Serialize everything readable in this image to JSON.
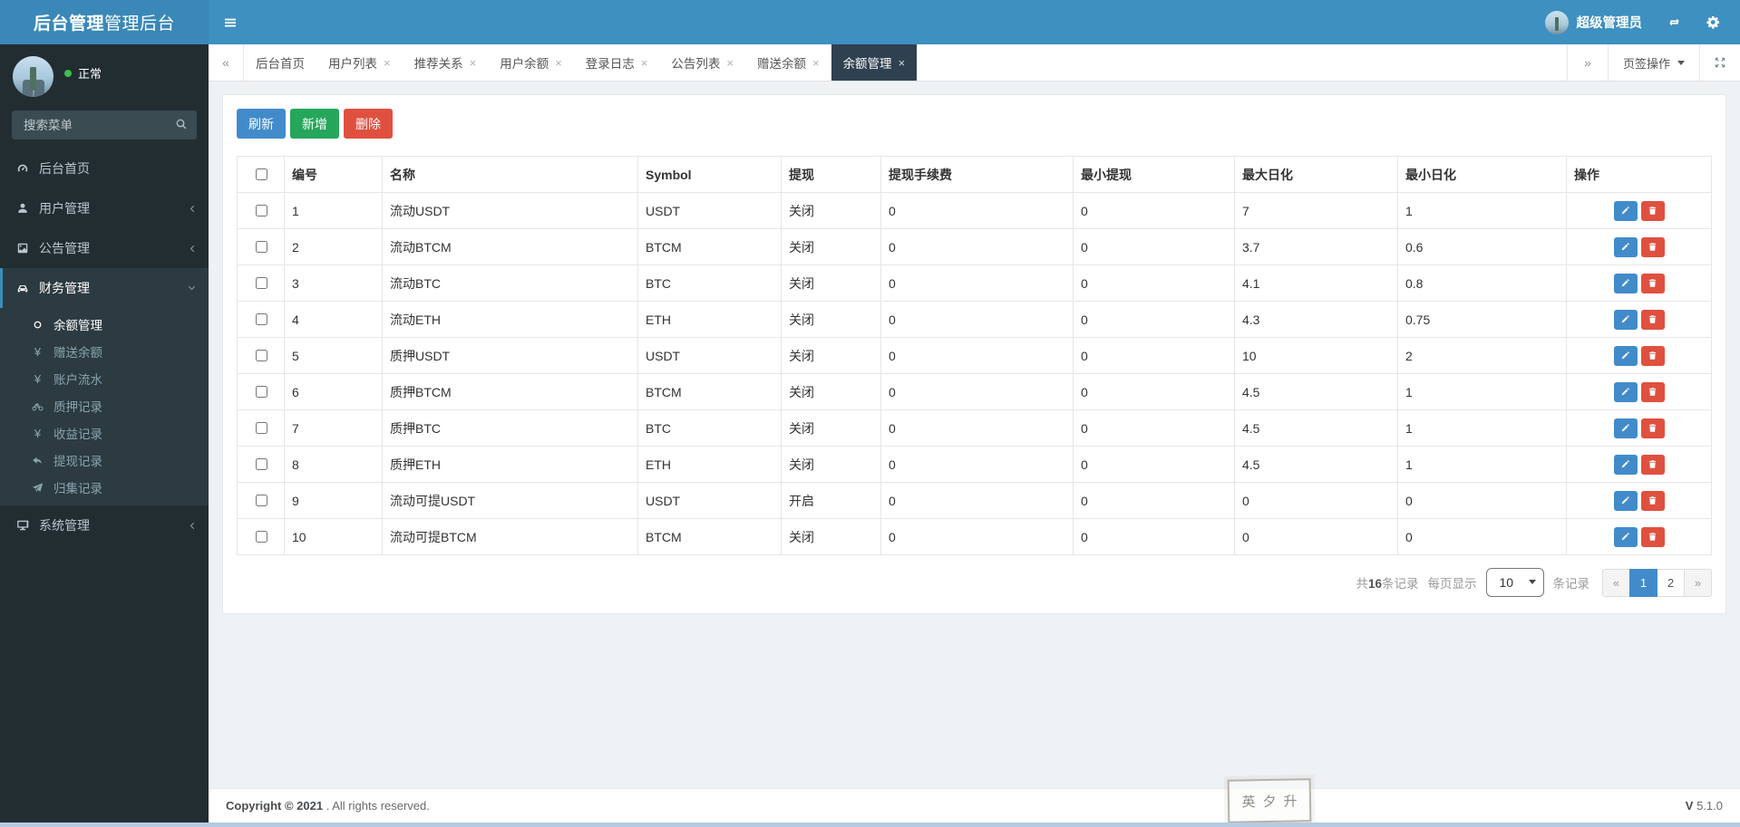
{
  "app": {
    "logo_bold": "后台管理",
    "logo_light": "管理后台"
  },
  "header": {
    "user_name": "超级管理员",
    "icons": [
      "hamburger-icon",
      "refresh-icon",
      "gear-icon"
    ]
  },
  "sidebar": {
    "status_label": "正常",
    "search_placeholder": "搜索菜单",
    "items": [
      {
        "label": "后台首页",
        "icon": "dashboard-icon"
      },
      {
        "label": "用户管理",
        "icon": "user-icon",
        "chevron": "left"
      },
      {
        "label": "公告管理",
        "icon": "image-icon",
        "chevron": "left"
      },
      {
        "label": "财务管理",
        "icon": "car-icon",
        "chevron": "down",
        "active": true,
        "children": [
          {
            "label": "余额管理",
            "icon": "circle-outline-icon",
            "active": true
          },
          {
            "label": "赠送余额",
            "icon": "yen-icon"
          },
          {
            "label": "账户流水",
            "icon": "yen-icon"
          },
          {
            "label": "质押记录",
            "icon": "motorcycle-icon"
          },
          {
            "label": "收益记录",
            "icon": "yen-icon"
          },
          {
            "label": "提现记录",
            "icon": "reply-arrow-icon"
          },
          {
            "label": "归集记录",
            "icon": "paper-plane-icon"
          }
        ]
      },
      {
        "label": "系统管理",
        "icon": "desktop-icon",
        "chevron": "left"
      }
    ]
  },
  "tabs": {
    "ops_label": "页签操作",
    "items": [
      {
        "label": "后台首页",
        "closable": false
      },
      {
        "label": "用户列表",
        "closable": true
      },
      {
        "label": "推荐关系",
        "closable": true
      },
      {
        "label": "用户余额",
        "closable": true
      },
      {
        "label": "登录日志",
        "closable": true
      },
      {
        "label": "公告列表",
        "closable": true
      },
      {
        "label": "赠送余额",
        "closable": true
      },
      {
        "label": "余额管理",
        "closable": true,
        "active": true
      }
    ]
  },
  "toolbar": {
    "refresh_label": "刷新",
    "add_label": "新增",
    "delete_label": "删除"
  },
  "table": {
    "columns": [
      {
        "key": "id",
        "label": "编号"
      },
      {
        "key": "name",
        "label": "名称"
      },
      {
        "key": "symbol",
        "label": "Symbol"
      },
      {
        "key": "withdraw",
        "label": "提现"
      },
      {
        "key": "fee",
        "label": "提现手续费"
      },
      {
        "key": "min_withdraw",
        "label": "最小提现"
      },
      {
        "key": "max_daily",
        "label": "最大日化"
      },
      {
        "key": "min_daily",
        "label": "最小日化"
      },
      {
        "key": "actions",
        "label": "操作"
      }
    ],
    "rows": [
      {
        "id": "1",
        "name": "流动USDT",
        "symbol": "USDT",
        "withdraw": "关闭",
        "fee": "0",
        "min_withdraw": "0",
        "max_daily": "7",
        "min_daily": "1"
      },
      {
        "id": "2",
        "name": "流动BTCM",
        "symbol": "BTCM",
        "withdraw": "关闭",
        "fee": "0",
        "min_withdraw": "0",
        "max_daily": "3.7",
        "min_daily": "0.6"
      },
      {
        "id": "3",
        "name": "流动BTC",
        "symbol": "BTC",
        "withdraw": "关闭",
        "fee": "0",
        "min_withdraw": "0",
        "max_daily": "4.1",
        "min_daily": "0.8"
      },
      {
        "id": "4",
        "name": "流动ETH",
        "symbol": "ETH",
        "withdraw": "关闭",
        "fee": "0",
        "min_withdraw": "0",
        "max_daily": "4.3",
        "min_daily": "0.75"
      },
      {
        "id": "5",
        "name": "质押USDT",
        "symbol": "USDT",
        "withdraw": "关闭",
        "fee": "0",
        "min_withdraw": "0",
        "max_daily": "10",
        "min_daily": "2"
      },
      {
        "id": "6",
        "name": "质押BTCM",
        "symbol": "BTCM",
        "withdraw": "关闭",
        "fee": "0",
        "min_withdraw": "0",
        "max_daily": "4.5",
        "min_daily": "1"
      },
      {
        "id": "7",
        "name": "质押BTC",
        "symbol": "BTC",
        "withdraw": "关闭",
        "fee": "0",
        "min_withdraw": "0",
        "max_daily": "4.5",
        "min_daily": "1"
      },
      {
        "id": "8",
        "name": "质押ETH",
        "symbol": "ETH",
        "withdraw": "关闭",
        "fee": "0",
        "min_withdraw": "0",
        "max_daily": "4.5",
        "min_daily": "1"
      },
      {
        "id": "9",
        "name": "流动可提USDT",
        "symbol": "USDT",
        "withdraw": "开启",
        "fee": "0",
        "min_withdraw": "0",
        "max_daily": "0",
        "min_daily": "0"
      },
      {
        "id": "10",
        "name": "流动可提BTCM",
        "symbol": "BTCM",
        "withdraw": "关闭",
        "fee": "0",
        "min_withdraw": "0",
        "max_daily": "0",
        "min_daily": "0"
      }
    ],
    "row_action_icons": [
      "pencil-icon",
      "trash-icon"
    ]
  },
  "pagination": {
    "total_prefix": "共",
    "total_count": "16",
    "total_suffix": "条记录",
    "per_page_label": "每页显示",
    "per_page_value": "10",
    "per_page_options": [
      "10"
    ],
    "per_page_suffix": "条记录",
    "pages": [
      {
        "label": "«",
        "name": "prev-page-button",
        "nav": true
      },
      {
        "label": "1",
        "name": "page-1-button",
        "active": true
      },
      {
        "label": "2",
        "name": "page-2-button"
      },
      {
        "label": "»",
        "name": "next-page-button",
        "nav": true
      }
    ]
  },
  "footer": {
    "copyright_bold": "Copyright © 2021",
    "copyright_rest": " . All rights reserved.",
    "version_bold": "V",
    "version_number": "5.1.0"
  },
  "stamp": {
    "chars": [
      "英",
      "夕",
      "升"
    ]
  },
  "colors": {
    "topbar_blue": "#3e90c0",
    "sidebar_dark": "#222d32",
    "active_tab_dark": "#2f4050",
    "accent_blue": "#428bca",
    "button_green": "#26a65b",
    "button_red": "#e0503f"
  }
}
